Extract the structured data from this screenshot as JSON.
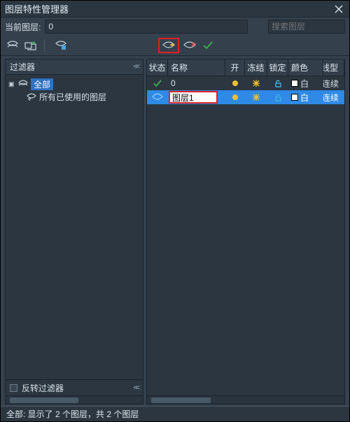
{
  "window": {
    "title": "图层特性管理器"
  },
  "topbar": {
    "current_layer_label": "当前图层:",
    "current_layer_value": "0",
    "search_placeholder": "搜索图层"
  },
  "filters": {
    "header": "过滤器",
    "collapse_glyph": "<<",
    "tree_root": "全部",
    "tree_child": "所有已使用的图层",
    "invert_label": "反转过滤器"
  },
  "grid": {
    "columns": {
      "state": "状态",
      "name": "名称",
      "on": "开",
      "freeze": "冻结",
      "lock": "锁定",
      "color": "颜色",
      "linetype": "线型"
    },
    "rows": [
      {
        "name": "0",
        "color_name": "白",
        "linetype": "连续",
        "current": true,
        "selected": false,
        "editing": false
      },
      {
        "name": "图层1",
        "color_name": "白",
        "linetype": "连续",
        "current": false,
        "selected": true,
        "editing": true
      }
    ]
  },
  "status": {
    "text": "全部: 显示了 2 个图层，共 2 个图层"
  },
  "icons": {
    "close": "close-icon",
    "search": "search-icon",
    "new_layer": "new-layer-icon",
    "new_layer_frozen": "new-layer-frozen-icon",
    "layer_states": "layer-states-icon",
    "delete_layer": "delete-layer-icon",
    "set_current": "set-current-icon",
    "checkmark": "check-icon",
    "sun": "sun-icon",
    "snowflake": "snowflake-icon",
    "unlock": "unlock-icon",
    "chevrons": "collapse-icon",
    "layer_row": "layer-row-icon"
  }
}
